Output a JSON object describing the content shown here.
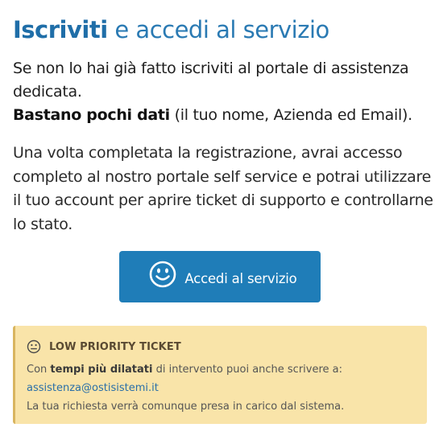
{
  "heading": {
    "bold": "Iscriviti",
    "rest": " e accedi al servizio"
  },
  "intro": {
    "line": "Se non lo hai già fatto iscriviti al portale di assistenza dedicata.",
    "bold": "Bastano pochi dati",
    "rest": " (il tuo nome, Azienda ed Email)."
  },
  "details": "Una volta completata la registrazione, avrai accesso completo al nostro portale self service e potrai utilizzare il tuo account per aprire ticket di supporto e controllarne lo stato.",
  "access_button": {
    "label": "Accedi al servizio",
    "icon": "smile-icon"
  },
  "notice": {
    "icon": "neutral-face-icon",
    "title": "LOW PRIORITY TICKET",
    "line1_pre": "Con ",
    "line1_bold": "tempi più dilatati",
    "line1_post": " di intervento puoi anche scrivere a:",
    "email": "assistenza@ostisistemi.it",
    "note": "La tua richiesta verrà comunque presa in carico dal sistema."
  },
  "colors": {
    "heading": "#2a7ab3",
    "button": "#1f7db8",
    "notice_bg": "#f9e4a9",
    "link": "#2a6fa8"
  }
}
